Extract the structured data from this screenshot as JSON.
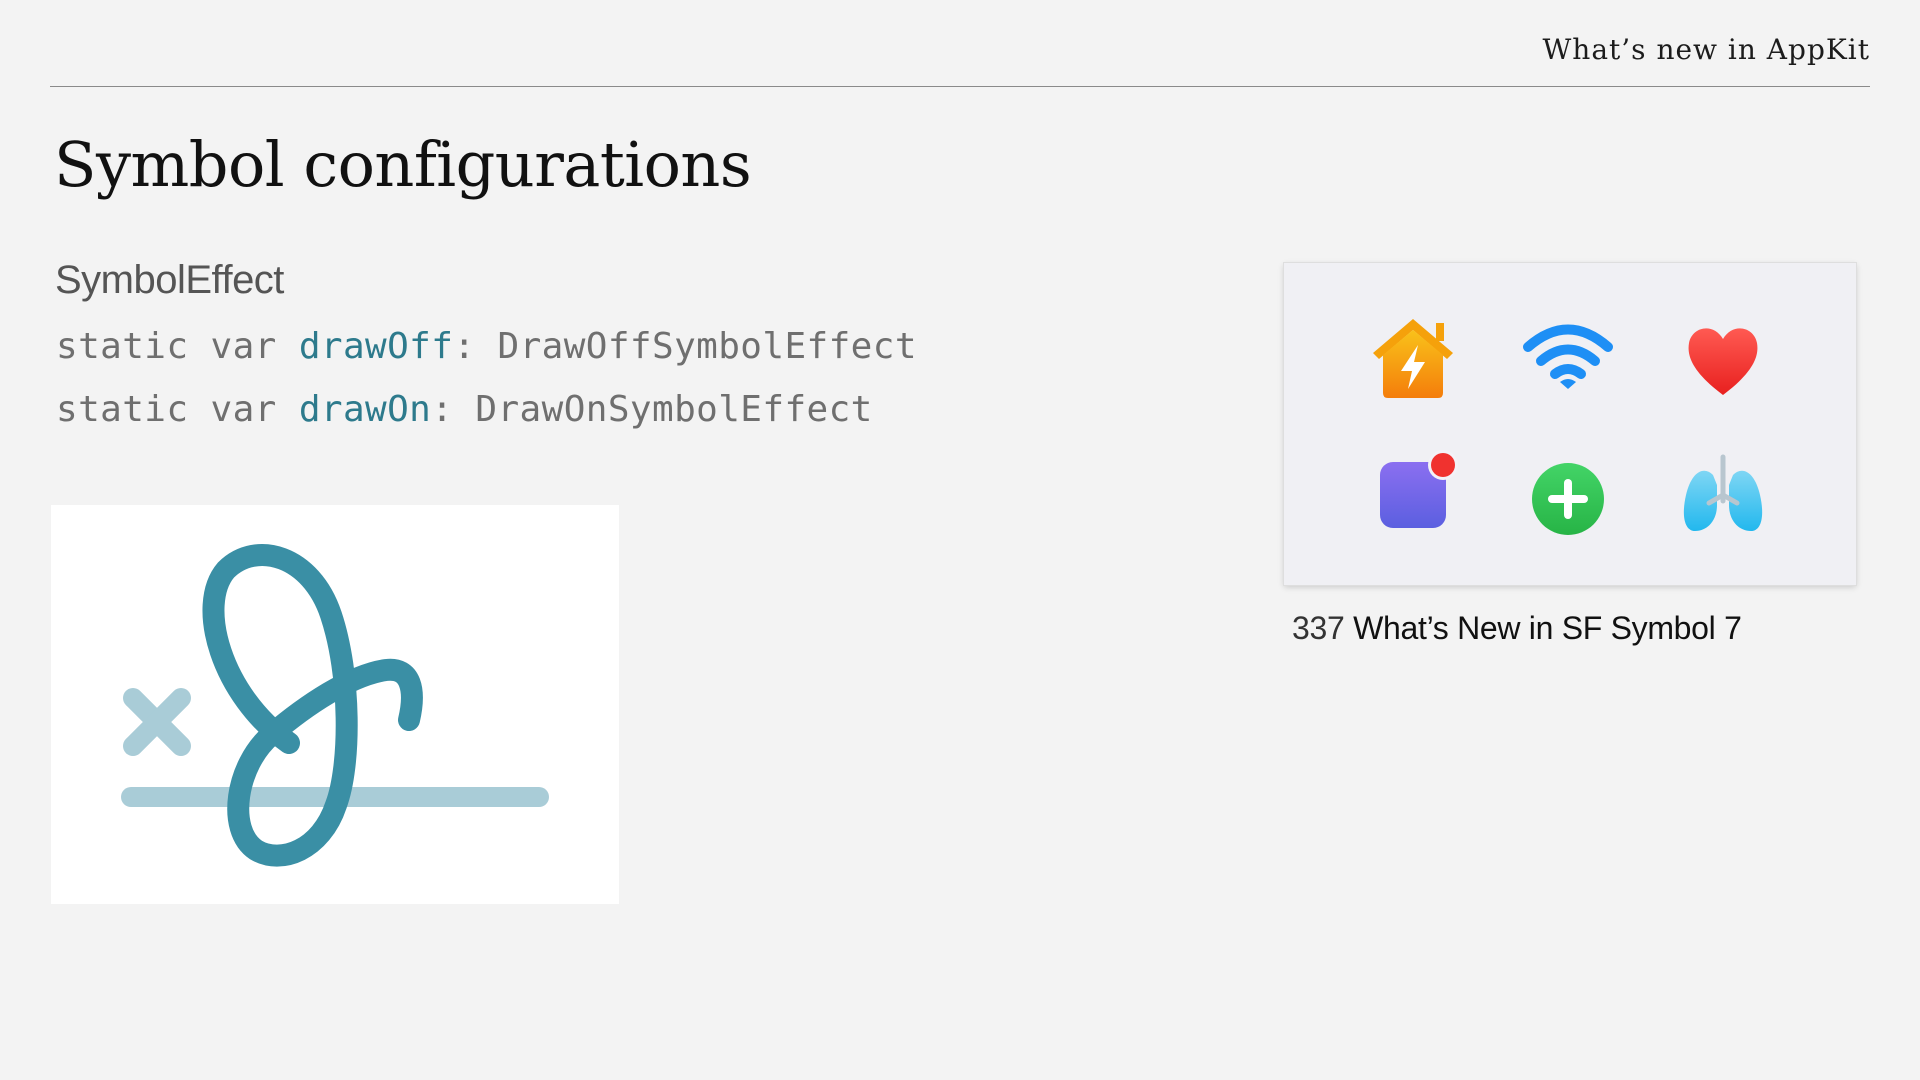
{
  "header": {
    "title": "What’s new in AppKit"
  },
  "slide": {
    "title": "Symbol configurations",
    "section_label": "SymbolEffect",
    "code": [
      {
        "prefix": "static var ",
        "identifier": "drawOff",
        "suffix": ": DrawOffSymbolEffect"
      },
      {
        "prefix": "static var ",
        "identifier": "drawOn",
        "suffix": ": DrawOnSymbolEffect"
      }
    ]
  },
  "illustration": {
    "icon": "signature-draw-icon",
    "colors": {
      "stroke": "#3a8fa5",
      "light": "#a9ccd7"
    }
  },
  "symbols_card": {
    "icons": [
      {
        "name": "house-bolt-icon",
        "color": "#f5a10b"
      },
      {
        "name": "wifi-icon",
        "color": "#1e8ff5"
      },
      {
        "name": "heart-icon",
        "color": "#f0322f"
      },
      {
        "name": "app-badge-icon",
        "color": "#6f67e8"
      },
      {
        "name": "plus-circle-icon",
        "color": "#2fc24f"
      },
      {
        "name": "lungs-icon",
        "color": "#34c3ea"
      }
    ]
  },
  "caption": {
    "number": "337",
    "text": " What’s New in SF Symbol 7"
  }
}
